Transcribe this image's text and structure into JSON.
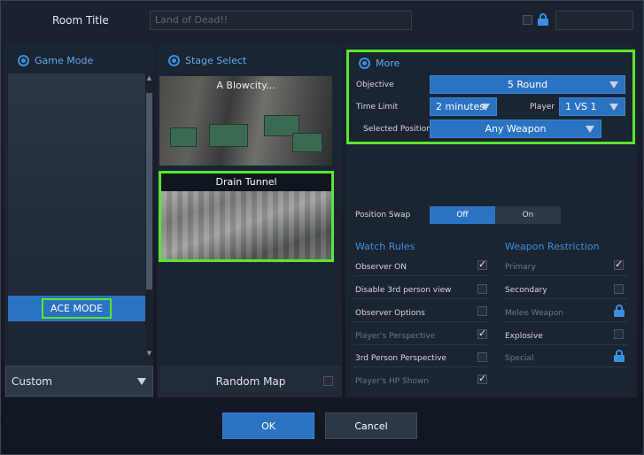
{
  "header": {
    "room_title_label": "Room Title",
    "room_title_value": "Land of Dead!!"
  },
  "game_mode": {
    "title": "Game Mode",
    "selected_mode": "ACE MODE",
    "dropdown_value": "Custom"
  },
  "stage_select": {
    "title": "Stage Select",
    "stages": [
      {
        "name": "A Blowcity..."
      },
      {
        "name": "Drain Tunnel"
      }
    ],
    "random_map_label": "Random Map"
  },
  "more": {
    "title": "More",
    "objective_label": "Objective",
    "objective_value": "5 Round",
    "time_limit_label": "Time Limit",
    "time_limit_value": "2 minutes",
    "player_label": "Player",
    "player_value": "1 VS 1",
    "selected_position_label": "Selected Position",
    "selected_position_value": "Any Weapon"
  },
  "position_swap": {
    "label": "Position Swap",
    "off_label": "Off",
    "on_label": "On"
  },
  "watch_rules": {
    "title": "Watch Rules",
    "items": [
      {
        "label": "Observer ON",
        "checked": true
      },
      {
        "label": "Disable 3rd person view",
        "checked": false
      },
      {
        "label": "Observer Options",
        "checked": false
      },
      {
        "label": "Player's Perspective",
        "checked": true
      },
      {
        "label": "3rd Person Perspective",
        "checked": false
      },
      {
        "label": "Player's HP Shown",
        "checked": true
      }
    ]
  },
  "weapon_restriction": {
    "title": "Weapon Restriction",
    "items": [
      {
        "label": "Primary",
        "state": "checked"
      },
      {
        "label": "Secondary",
        "state": "unchecked"
      },
      {
        "label": "Melee Weapon",
        "state": "locked"
      },
      {
        "label": "Explosive",
        "state": "unchecked"
      },
      {
        "label": "Special",
        "state": "locked"
      }
    ]
  },
  "footer": {
    "ok_label": "OK",
    "cancel_label": "Cancel"
  },
  "colors": {
    "accent_blue": "#2b73c2",
    "highlight_green": "#5ae62d",
    "header_blue": "#63a9ea"
  }
}
